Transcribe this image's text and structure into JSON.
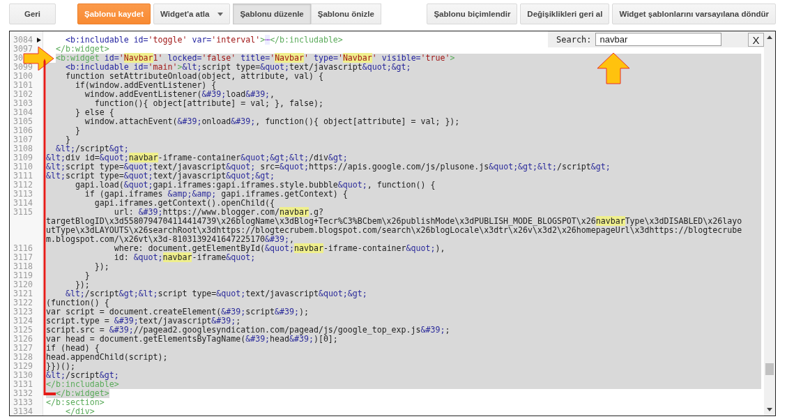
{
  "toolbar": {
    "buttons_left": [
      {
        "label": "Geri",
        "kind": "plain"
      },
      {
        "label": "Şablonu kaydet",
        "kind": "primary"
      },
      {
        "label": "Widget'a atla",
        "kind": "dropdown"
      }
    ],
    "mode_tabs": [
      {
        "label": "Şablonu düzenle",
        "selected": true
      },
      {
        "label": "Şablonu önizle",
        "selected": false
      }
    ],
    "buttons_right": [
      {
        "label": "Şablonu biçimlendir",
        "kind": "plain"
      },
      {
        "label": "Değişiklikleri geri al",
        "kind": "plain"
      },
      {
        "label": "Widget şablonlarını varsayılana döndür",
        "kind": "plain"
      }
    ]
  },
  "search": {
    "label": "Search:",
    "query": "navbar",
    "close": "X"
  },
  "editor": {
    "lines": [
      {
        "number": "3084",
        "kind": "folded",
        "selected": false,
        "segments": [
          {
            "kind": "attr",
            "text": "    <b:includable id="
          },
          {
            "kind": "value",
            "text": "'toggle'"
          },
          {
            "kind": "attr",
            "text": " var="
          },
          {
            "kind": "value",
            "text": "'interval'"
          },
          {
            "kind": "tag",
            "text": ">"
          },
          {
            "kind": "fold",
            "text": "⋯"
          },
          {
            "kind": "tag",
            "text": "</b:includable>"
          }
        ]
      },
      {
        "number": "3097",
        "kind": "code",
        "selected": false,
        "segments": [
          {
            "kind": "tag",
            "text": "  </b:widget>"
          }
        ]
      },
      {
        "number": "30",
        "kind": "selection-start",
        "selected": true,
        "segments": [
          {
            "kind": "tag",
            "text": "  <b:widget"
          },
          {
            "kind": "attr",
            "text": " id="
          },
          {
            "kind": "value",
            "text": "'"
          },
          {
            "kind": "value-match",
            "text": "Navbar"
          },
          {
            "kind": "value",
            "text": "1'"
          },
          {
            "kind": "attr",
            "text": " locked="
          },
          {
            "kind": "value",
            "text": "'false'"
          },
          {
            "kind": "attr",
            "text": " title="
          },
          {
            "kind": "value",
            "text": "'"
          },
          {
            "kind": "value-match",
            "text": "Navbar"
          },
          {
            "kind": "value",
            "text": "'"
          },
          {
            "kind": "attr",
            "text": " type="
          },
          {
            "kind": "value",
            "text": "'"
          },
          {
            "kind": "value-match",
            "text": "Navbar"
          },
          {
            "kind": "value",
            "text": "'"
          },
          {
            "kind": "attr",
            "text": " visible="
          },
          {
            "kind": "value",
            "text": "'true'"
          },
          {
            "kind": "tag",
            "text": ">"
          }
        ]
      },
      {
        "number": "3099",
        "kind": "code",
        "selected": true,
        "segments": [
          {
            "kind": "attr",
            "text": "    <b:includable id="
          },
          {
            "kind": "value",
            "text": "'main'"
          },
          {
            "kind": "tag",
            "text": ">"
          },
          {
            "kind": "entity",
            "text": "&lt;"
          },
          {
            "kind": "plain",
            "text": "script type="
          },
          {
            "kind": "entity",
            "text": "&quot;"
          },
          {
            "kind": "plain",
            "text": "text/javascript"
          },
          {
            "kind": "entity",
            "text": "&quot;&gt;"
          }
        ]
      },
      {
        "number": "3100",
        "kind": "code",
        "selected": true,
        "segments": [
          {
            "kind": "plain",
            "text": "    function setAttributeOnload(object, attribute, val) {"
          }
        ]
      },
      {
        "number": "3101",
        "kind": "code",
        "selected": true,
        "segments": [
          {
            "kind": "plain",
            "text": "      if(window.addEventListener) {"
          }
        ]
      },
      {
        "number": "3102",
        "kind": "code",
        "selected": true,
        "segments": [
          {
            "kind": "plain",
            "text": "        window.addEventListener("
          },
          {
            "kind": "entity",
            "text": "&#39;"
          },
          {
            "kind": "plain",
            "text": "load"
          },
          {
            "kind": "entity",
            "text": "&#39;"
          },
          {
            "kind": "plain",
            "text": ","
          }
        ]
      },
      {
        "number": "3103",
        "kind": "code",
        "selected": true,
        "segments": [
          {
            "kind": "plain",
            "text": "          function(){ object[attribute] = val; }, false);"
          }
        ]
      },
      {
        "number": "3104",
        "kind": "code",
        "selected": true,
        "segments": [
          {
            "kind": "plain",
            "text": "      } else {"
          }
        ]
      },
      {
        "number": "3105",
        "kind": "code",
        "selected": true,
        "segments": [
          {
            "kind": "plain",
            "text": "        window.attachEvent("
          },
          {
            "kind": "entity",
            "text": "&#39;"
          },
          {
            "kind": "plain",
            "text": "onload"
          },
          {
            "kind": "entity",
            "text": "&#39;"
          },
          {
            "kind": "plain",
            "text": ", function(){ object[attribute] = val; });"
          }
        ]
      },
      {
        "number": "3106",
        "kind": "code",
        "selected": true,
        "segments": [
          {
            "kind": "plain",
            "text": "      }"
          }
        ]
      },
      {
        "number": "3107",
        "kind": "code",
        "selected": true,
        "segments": [
          {
            "kind": "plain",
            "text": "    }"
          }
        ]
      },
      {
        "number": "3108",
        "kind": "code",
        "selected": true,
        "segments": [
          {
            "kind": "entity",
            "text": "  &lt;"
          },
          {
            "kind": "plain",
            "text": "/script"
          },
          {
            "kind": "entity",
            "text": "&gt;"
          }
        ]
      },
      {
        "number": "3109",
        "kind": "code",
        "selected": true,
        "segments": [
          {
            "kind": "entity",
            "text": "&lt;"
          },
          {
            "kind": "plain",
            "text": "div id="
          },
          {
            "kind": "entity",
            "text": "&quot;"
          },
          {
            "kind": "match",
            "text": "navbar"
          },
          {
            "kind": "plain",
            "text": "-iframe-container"
          },
          {
            "kind": "entity",
            "text": "&quot;&gt;&lt;"
          },
          {
            "kind": "plain",
            "text": "/div"
          },
          {
            "kind": "entity",
            "text": "&gt;"
          }
        ]
      },
      {
        "number": "3110",
        "kind": "code",
        "selected": true,
        "segments": [
          {
            "kind": "entity",
            "text": "&lt;"
          },
          {
            "kind": "plain",
            "text": "script type="
          },
          {
            "kind": "entity",
            "text": "&quot;"
          },
          {
            "kind": "plain",
            "text": "text/javascript"
          },
          {
            "kind": "entity",
            "text": "&quot;"
          },
          {
            "kind": "plain",
            "text": " src="
          },
          {
            "kind": "entity",
            "text": "&quot;"
          },
          {
            "kind": "plain",
            "text": "https://apis.google.com/js/plusone.js"
          },
          {
            "kind": "entity",
            "text": "&quot;&gt;&lt;"
          },
          {
            "kind": "plain",
            "text": "/script"
          },
          {
            "kind": "entity",
            "text": "&gt;"
          }
        ]
      },
      {
        "number": "3111",
        "kind": "code",
        "selected": true,
        "segments": [
          {
            "kind": "entity",
            "text": "&lt;"
          },
          {
            "kind": "plain",
            "text": "script type="
          },
          {
            "kind": "entity",
            "text": "&quot;"
          },
          {
            "kind": "plain",
            "text": "text/javascript"
          },
          {
            "kind": "entity",
            "text": "&quot;&gt;"
          }
        ]
      },
      {
        "number": "3112",
        "kind": "code",
        "selected": true,
        "segments": [
          {
            "kind": "plain",
            "text": "      gapi.load("
          },
          {
            "kind": "entity",
            "text": "&quot;"
          },
          {
            "kind": "plain",
            "text": "gapi.iframes:gapi.iframes.style.bubble"
          },
          {
            "kind": "entity",
            "text": "&quot;"
          },
          {
            "kind": "plain",
            "text": ", function() {"
          }
        ]
      },
      {
        "number": "3113",
        "kind": "code",
        "selected": true,
        "segments": [
          {
            "kind": "plain",
            "text": "        if (gapi.iframes "
          },
          {
            "kind": "entity",
            "text": "&amp;&amp;"
          },
          {
            "kind": "plain",
            "text": " gapi.iframes.getContext) {"
          }
        ]
      },
      {
        "number": "3114",
        "kind": "code",
        "selected": true,
        "segments": [
          {
            "kind": "plain",
            "text": "          gapi.iframes.getContext().openChild({"
          }
        ]
      },
      {
        "number": "3115",
        "kind": "code",
        "selected": true,
        "segments": [
          {
            "kind": "plain",
            "text": "              url: "
          },
          {
            "kind": "entity",
            "text": "&#39;"
          },
          {
            "kind": "plain",
            "text": "https://www.blogger.com/"
          },
          {
            "kind": "match",
            "text": "navbar"
          },
          {
            "kind": "plain",
            "text": ".g?"
          }
        ]
      },
      {
        "kind": "continuation",
        "selected": true,
        "segments": [
          {
            "kind": "plain",
            "text": "targetBlogID\\x3d5580794704114414739\\x26blogName\\x3dBlog+Tecr%C3%BCbem\\x26publishMode\\x3dPUBLISH_MODE_BLOGSPOT\\x26"
          },
          {
            "kind": "match",
            "text": "navbar"
          },
          {
            "kind": "plain",
            "text": "Type\\x3dDISABLED\\x26layo"
          }
        ]
      },
      {
        "kind": "continuation",
        "selected": true,
        "segments": [
          {
            "kind": "plain",
            "text": "utType\\x3dLAYOUTS\\x26searchRoot\\x3dhttps://blogtecrubem.blogspot.com/search\\x26blogLocale\\x3dtr\\x26v\\x3d2\\x26homepageUrl\\x3dhttps://blogtecrube"
          }
        ]
      },
      {
        "kind": "continuation",
        "selected": true,
        "segments": [
          {
            "kind": "plain",
            "text": "m.blogspot.com/\\x26vt\\x3d-8103139241647225170"
          },
          {
            "kind": "entity",
            "text": "&#39;"
          },
          {
            "kind": "plain",
            "text": ","
          }
        ]
      },
      {
        "number": "3116",
        "kind": "code",
        "selected": true,
        "segments": [
          {
            "kind": "plain",
            "text": "              where: document.getElementById("
          },
          {
            "kind": "entity",
            "text": "&quot;"
          },
          {
            "kind": "match",
            "text": "navbar"
          },
          {
            "kind": "plain",
            "text": "-iframe-container"
          },
          {
            "kind": "entity",
            "text": "&quot;"
          },
          {
            "kind": "plain",
            "text": "),"
          }
        ]
      },
      {
        "number": "3117",
        "kind": "code",
        "selected": true,
        "segments": [
          {
            "kind": "plain",
            "text": "              id: "
          },
          {
            "kind": "entity",
            "text": "&quot;"
          },
          {
            "kind": "match",
            "text": "navbar"
          },
          {
            "kind": "plain",
            "text": "-iframe"
          },
          {
            "kind": "entity",
            "text": "&quot;"
          }
        ]
      },
      {
        "number": "3118",
        "kind": "code",
        "selected": true,
        "segments": [
          {
            "kind": "plain",
            "text": "          });"
          }
        ]
      },
      {
        "number": "3119",
        "kind": "code",
        "selected": true,
        "segments": [
          {
            "kind": "plain",
            "text": "        }"
          }
        ]
      },
      {
        "number": "3120",
        "kind": "code",
        "selected": true,
        "segments": [
          {
            "kind": "plain",
            "text": "      });"
          }
        ]
      },
      {
        "number": "3121",
        "kind": "code",
        "selected": true,
        "segments": [
          {
            "kind": "entity",
            "text": "    &lt;"
          },
          {
            "kind": "plain",
            "text": "/script"
          },
          {
            "kind": "entity",
            "text": "&gt;&lt;"
          },
          {
            "kind": "plain",
            "text": "script type="
          },
          {
            "kind": "entity",
            "text": "&quot;"
          },
          {
            "kind": "plain",
            "text": "text/javascript"
          },
          {
            "kind": "entity",
            "text": "&quot;&gt;"
          }
        ]
      },
      {
        "number": "3122",
        "kind": "code",
        "selected": true,
        "segments": [
          {
            "kind": "plain",
            "text": "(function() {"
          }
        ]
      },
      {
        "number": "3123",
        "kind": "code",
        "selected": true,
        "segments": [
          {
            "kind": "plain",
            "text": "var script = document.createElement("
          },
          {
            "kind": "entity",
            "text": "&#39;"
          },
          {
            "kind": "plain",
            "text": "script"
          },
          {
            "kind": "entity",
            "text": "&#39;"
          },
          {
            "kind": "plain",
            "text": ");"
          }
        ]
      },
      {
        "number": "3124",
        "kind": "code",
        "selected": true,
        "segments": [
          {
            "kind": "plain",
            "text": "script.type = "
          },
          {
            "kind": "entity",
            "text": "&#39;"
          },
          {
            "kind": "plain",
            "text": "text/javascript"
          },
          {
            "kind": "entity",
            "text": "&#39;"
          },
          {
            "kind": "plain",
            "text": ";"
          }
        ]
      },
      {
        "number": "3125",
        "kind": "code",
        "selected": true,
        "segments": [
          {
            "kind": "plain",
            "text": "script.src = "
          },
          {
            "kind": "entity",
            "text": "&#39;"
          },
          {
            "kind": "plain",
            "text": "//pagead2.googlesyndication.com/pagead/js/google_top_exp.js"
          },
          {
            "kind": "entity",
            "text": "&#39;"
          },
          {
            "kind": "plain",
            "text": ";"
          }
        ]
      },
      {
        "number": "3126",
        "kind": "code",
        "selected": true,
        "segments": [
          {
            "kind": "plain",
            "text": "var head = document.getElementsByTagName("
          },
          {
            "kind": "entity",
            "text": "&#39;"
          },
          {
            "kind": "plain",
            "text": "head"
          },
          {
            "kind": "entity",
            "text": "&#39;"
          },
          {
            "kind": "plain",
            "text": ")[0];"
          }
        ]
      },
      {
        "number": "3127",
        "kind": "code",
        "selected": true,
        "segments": [
          {
            "kind": "plain",
            "text": "if (head) {"
          }
        ]
      },
      {
        "number": "3128",
        "kind": "code",
        "selected": true,
        "segments": [
          {
            "kind": "plain",
            "text": "head.appendChild(script);"
          }
        ]
      },
      {
        "number": "3129",
        "kind": "code",
        "selected": true,
        "segments": [
          {
            "kind": "plain",
            "text": "}})();"
          }
        ]
      },
      {
        "number": "3130",
        "kind": "code",
        "selected": true,
        "segments": [
          {
            "kind": "entity",
            "text": "&lt;"
          },
          {
            "kind": "plain",
            "text": "/script"
          },
          {
            "kind": "entity",
            "text": "&gt;"
          }
        ]
      },
      {
        "number": "3131",
        "kind": "code",
        "selected": true,
        "segments": [
          {
            "kind": "tag",
            "text": "</b:includable>"
          }
        ]
      },
      {
        "number": "3132",
        "kind": "selection-end",
        "selected": true,
        "segments": [
          {
            "kind": "tag",
            "text": "  </b:widget>"
          }
        ]
      },
      {
        "number": "3133",
        "kind": "code",
        "selected": false,
        "segments": [
          {
            "kind": "tag",
            "text": "</b:section>"
          }
        ]
      },
      {
        "number": "3134",
        "kind": "code",
        "selected": false,
        "segments": [
          {
            "kind": "tag",
            "text": "    </div>"
          }
        ]
      }
    ]
  }
}
